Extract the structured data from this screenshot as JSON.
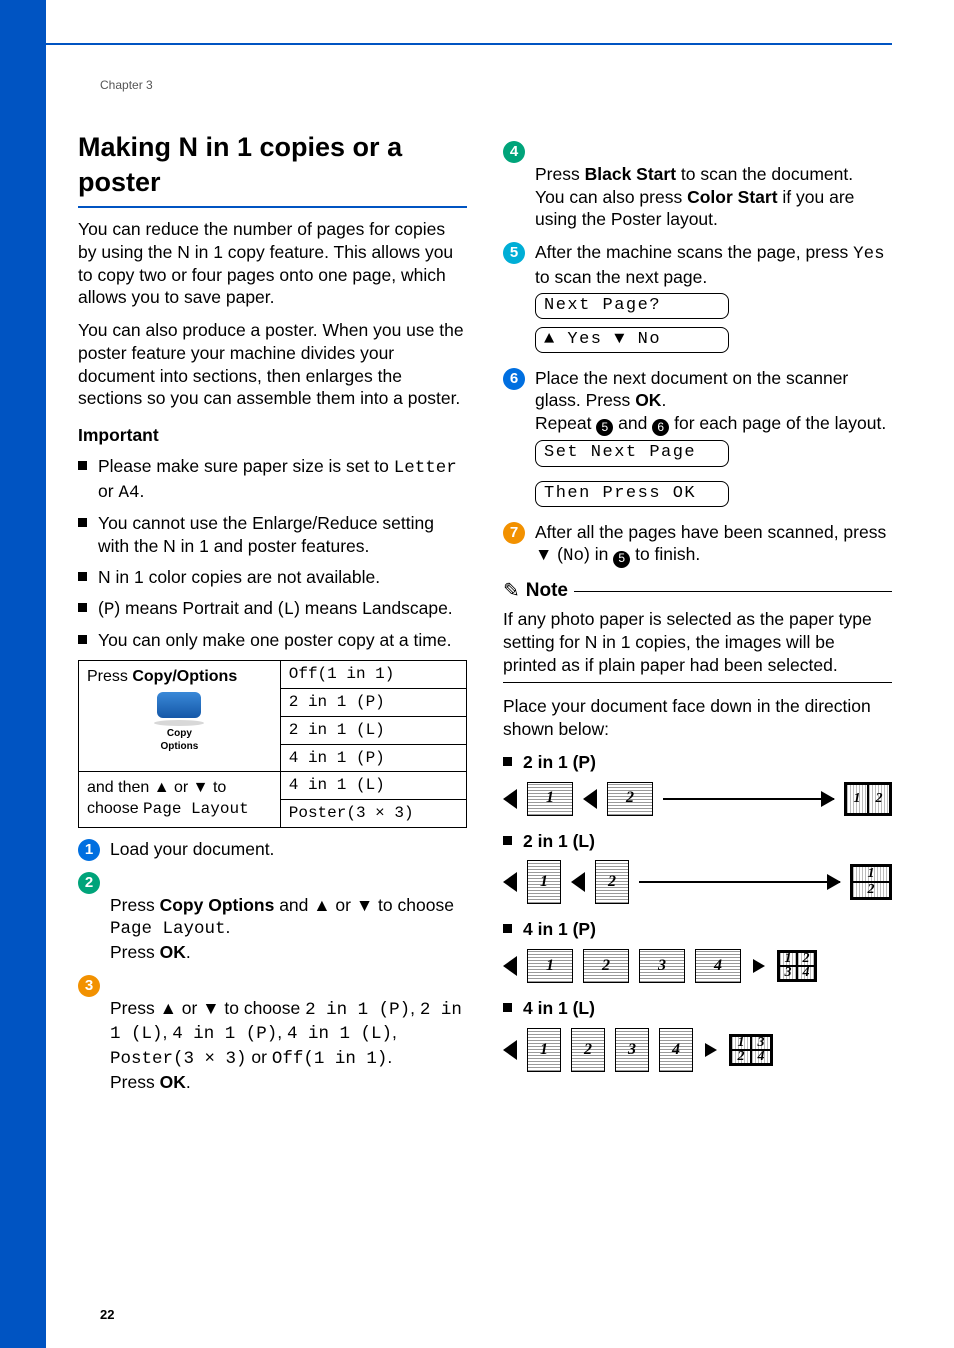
{
  "chapter": "Chapter 3",
  "page_number": "22",
  "section_title": "Making N in 1 copies or a poster",
  "intro1": "You can reduce the number of pages for copies by using the N in 1 copy feature. This allows you to copy two or four pages onto one page, which allows you to save paper.",
  "intro2": "You can also produce a poster. When you use the poster feature your machine divides your document into sections, then enlarges the sections so you can assemble them into a poster.",
  "important_label": "Important",
  "bullets": {
    "b1a": "Please make sure paper size is set to ",
    "b1b": "Letter",
    "b1c": " or ",
    "b1d": "A4",
    "b1e": ".",
    "b2": "You cannot use the Enlarge/Reduce setting with the N in 1 and poster features.",
    "b3": "N in 1 color copies are not available.",
    "b4a": "(",
    "b4p": "P",
    "b4b": ") means Portrait and (",
    "b4l": "L",
    "b4c": ") means Landscape.",
    "b5": "You can only make one poster copy at a time."
  },
  "table": {
    "left1a": "Press ",
    "left1b": "Copy/Options",
    "left2": "Copy\nOptions",
    "left3a": "and then ▲ or ▼ to choose ",
    "left3b": "Page Layout",
    "r1": "Off(1 in 1)",
    "r2": "2 in 1 (P)",
    "r3": "2 in 1 (L)",
    "r4": "4 in 1 (P)",
    "r5": "4 in 1 (L)",
    "r6": "Poster(3 × 3)"
  },
  "steps_left": {
    "s1": "Load your document.",
    "s2a": "Press ",
    "s2b": "Copy Options",
    "s2c": " and ▲ or ▼ to choose ",
    "s2d": "Page Layout",
    "s2e": ".\nPress ",
    "s2f": "OK",
    "s2g": ".",
    "s3a": "Press ▲ or ▼ to choose ",
    "s3b": "2 in 1 (P)",
    "s3c": ", ",
    "s3d": "2 in 1 (L)",
    "s3e": ", ",
    "s3f": "4 in 1 (P)",
    "s3g": ", ",
    "s3h": "4 in 1 (L)",
    "s3i": ", ",
    "s3j": "Poster(3 × 3)",
    "s3k": " or ",
    "s3l": "Off(1 in 1)",
    "s3m": ".\nPress ",
    "s3n": "OK",
    "s3o": "."
  },
  "steps_right": {
    "s4a": "Press ",
    "s4b": "Black Start",
    "s4c": " to scan the document.\nYou can also press ",
    "s4d": "Color Start",
    "s4e": " if you are using the Poster layout.",
    "s5a": "After the machine scans the page, press ",
    "s5b": "Yes",
    "s5c": " to scan the next page.",
    "lcd1": "Next Page?",
    "lcd2": "▲ Yes ▼ No",
    "s6a": "Place the next document on the scanner glass. Press ",
    "s6b": "OK",
    "s6c": ".\nRepeat ",
    "s6d": " and ",
    "s6e": " for each page of the layout.",
    "lcd3": "Set Next Page",
    "lcd4": "Then Press OK",
    "s7a": "After all the pages have been scanned, press ▼ (",
    "s7b": "No",
    "s7c": ") in ",
    "s7d": " to finish."
  },
  "note": {
    "label": "Note",
    "body": "If any photo paper is selected as the paper type setting for N in 1 copies, the images will be printed as if plain paper had been selected."
  },
  "layout_intro": "Place your document face down in the direction shown below:",
  "layouts": {
    "h1": "2 in 1 (P)",
    "h2": "2 in 1 (L)",
    "h3": "4 in 1 (P)",
    "h4": "4 in 1 (L)"
  }
}
